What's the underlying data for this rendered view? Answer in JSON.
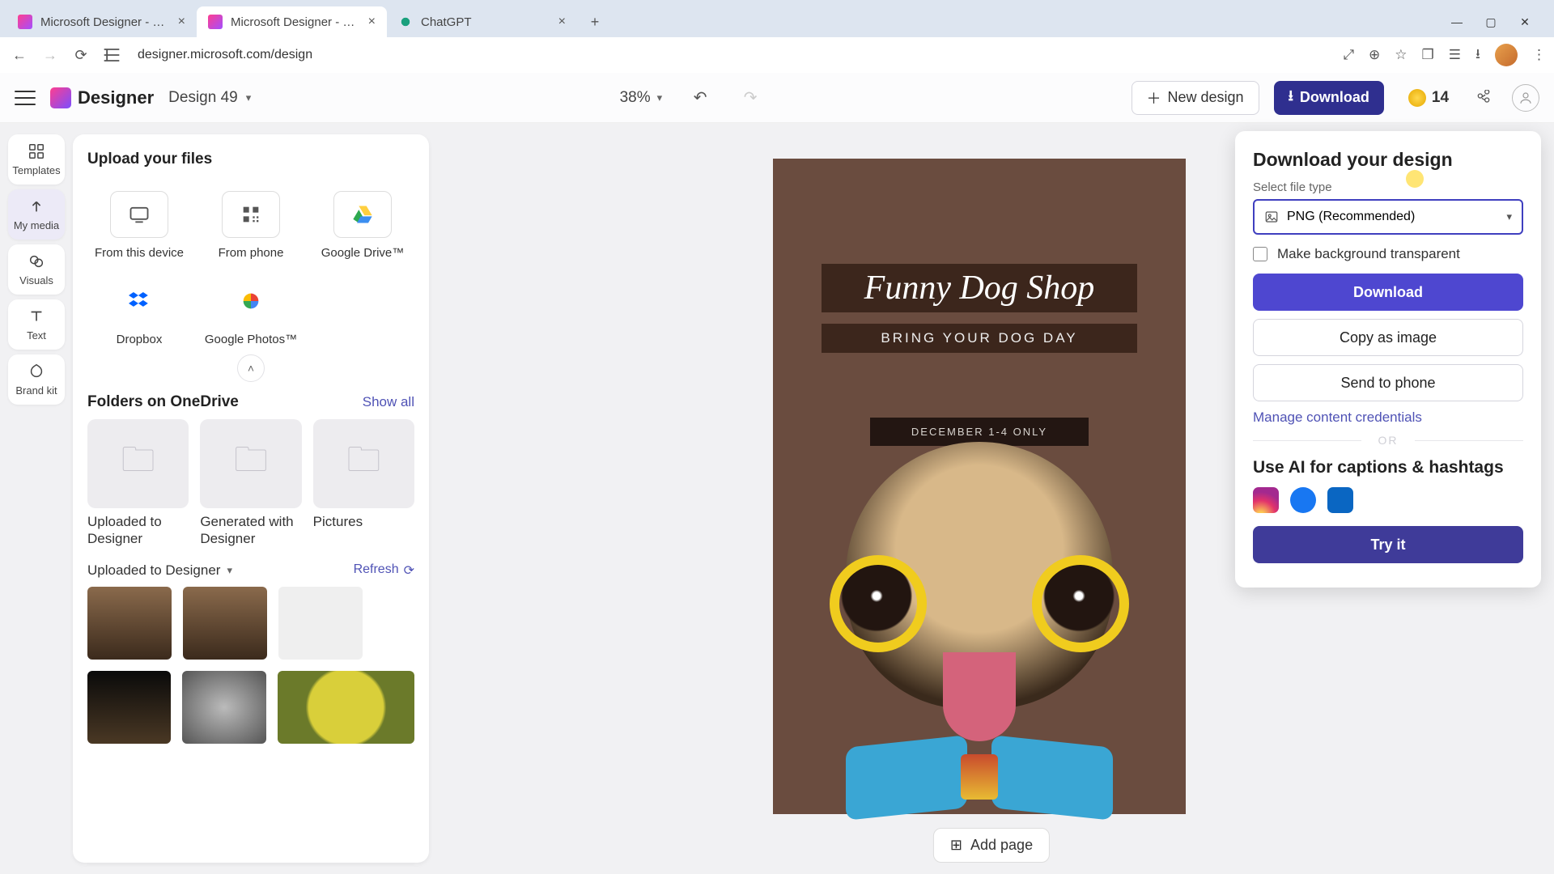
{
  "browser": {
    "tabs": [
      {
        "title": "Microsoft Designer - Stunning"
      },
      {
        "title": "Microsoft Designer - Stunning"
      },
      {
        "title": "ChatGPT"
      }
    ],
    "url": "designer.microsoft.com/design"
  },
  "appbar": {
    "logo_text": "Designer",
    "design_name": "Design 49",
    "zoom": "38%",
    "new_design": "New design",
    "download": "Download",
    "credits": "14"
  },
  "rail": {
    "templates": "Templates",
    "my_media": "My media",
    "visuals": "Visuals",
    "text": "Text",
    "brand_kit": "Brand kit"
  },
  "panel": {
    "upload_heading": "Upload your files",
    "sources": {
      "device": "From this device",
      "phone": "From phone",
      "gdrive": "Google Drive™",
      "dropbox": "Dropbox",
      "gphotos": "Google Photos™"
    },
    "folders_heading": "Folders on OneDrive",
    "show_all": "Show all",
    "folders": [
      "Uploaded to Designer",
      "Generated with Designer",
      "Pictures"
    ],
    "subfolder": "Uploaded to Designer",
    "refresh": "Refresh"
  },
  "canvas": {
    "title": "Funny Dog Shop",
    "subtitle": "BRING YOUR DOG DAY",
    "date_line": "DECEMBER 1-4 ONLY",
    "add_page": "Add page"
  },
  "popover": {
    "heading": "Download your design",
    "select_label": "Select file type",
    "file_type": "PNG (Recommended)",
    "transparent": "Make background transparent",
    "download": "Download",
    "copy": "Copy as image",
    "send": "Send to phone",
    "manage": "Manage content credentials",
    "or": "OR",
    "ai_heading": "Use AI for captions & hashtags",
    "try": "Try it"
  }
}
